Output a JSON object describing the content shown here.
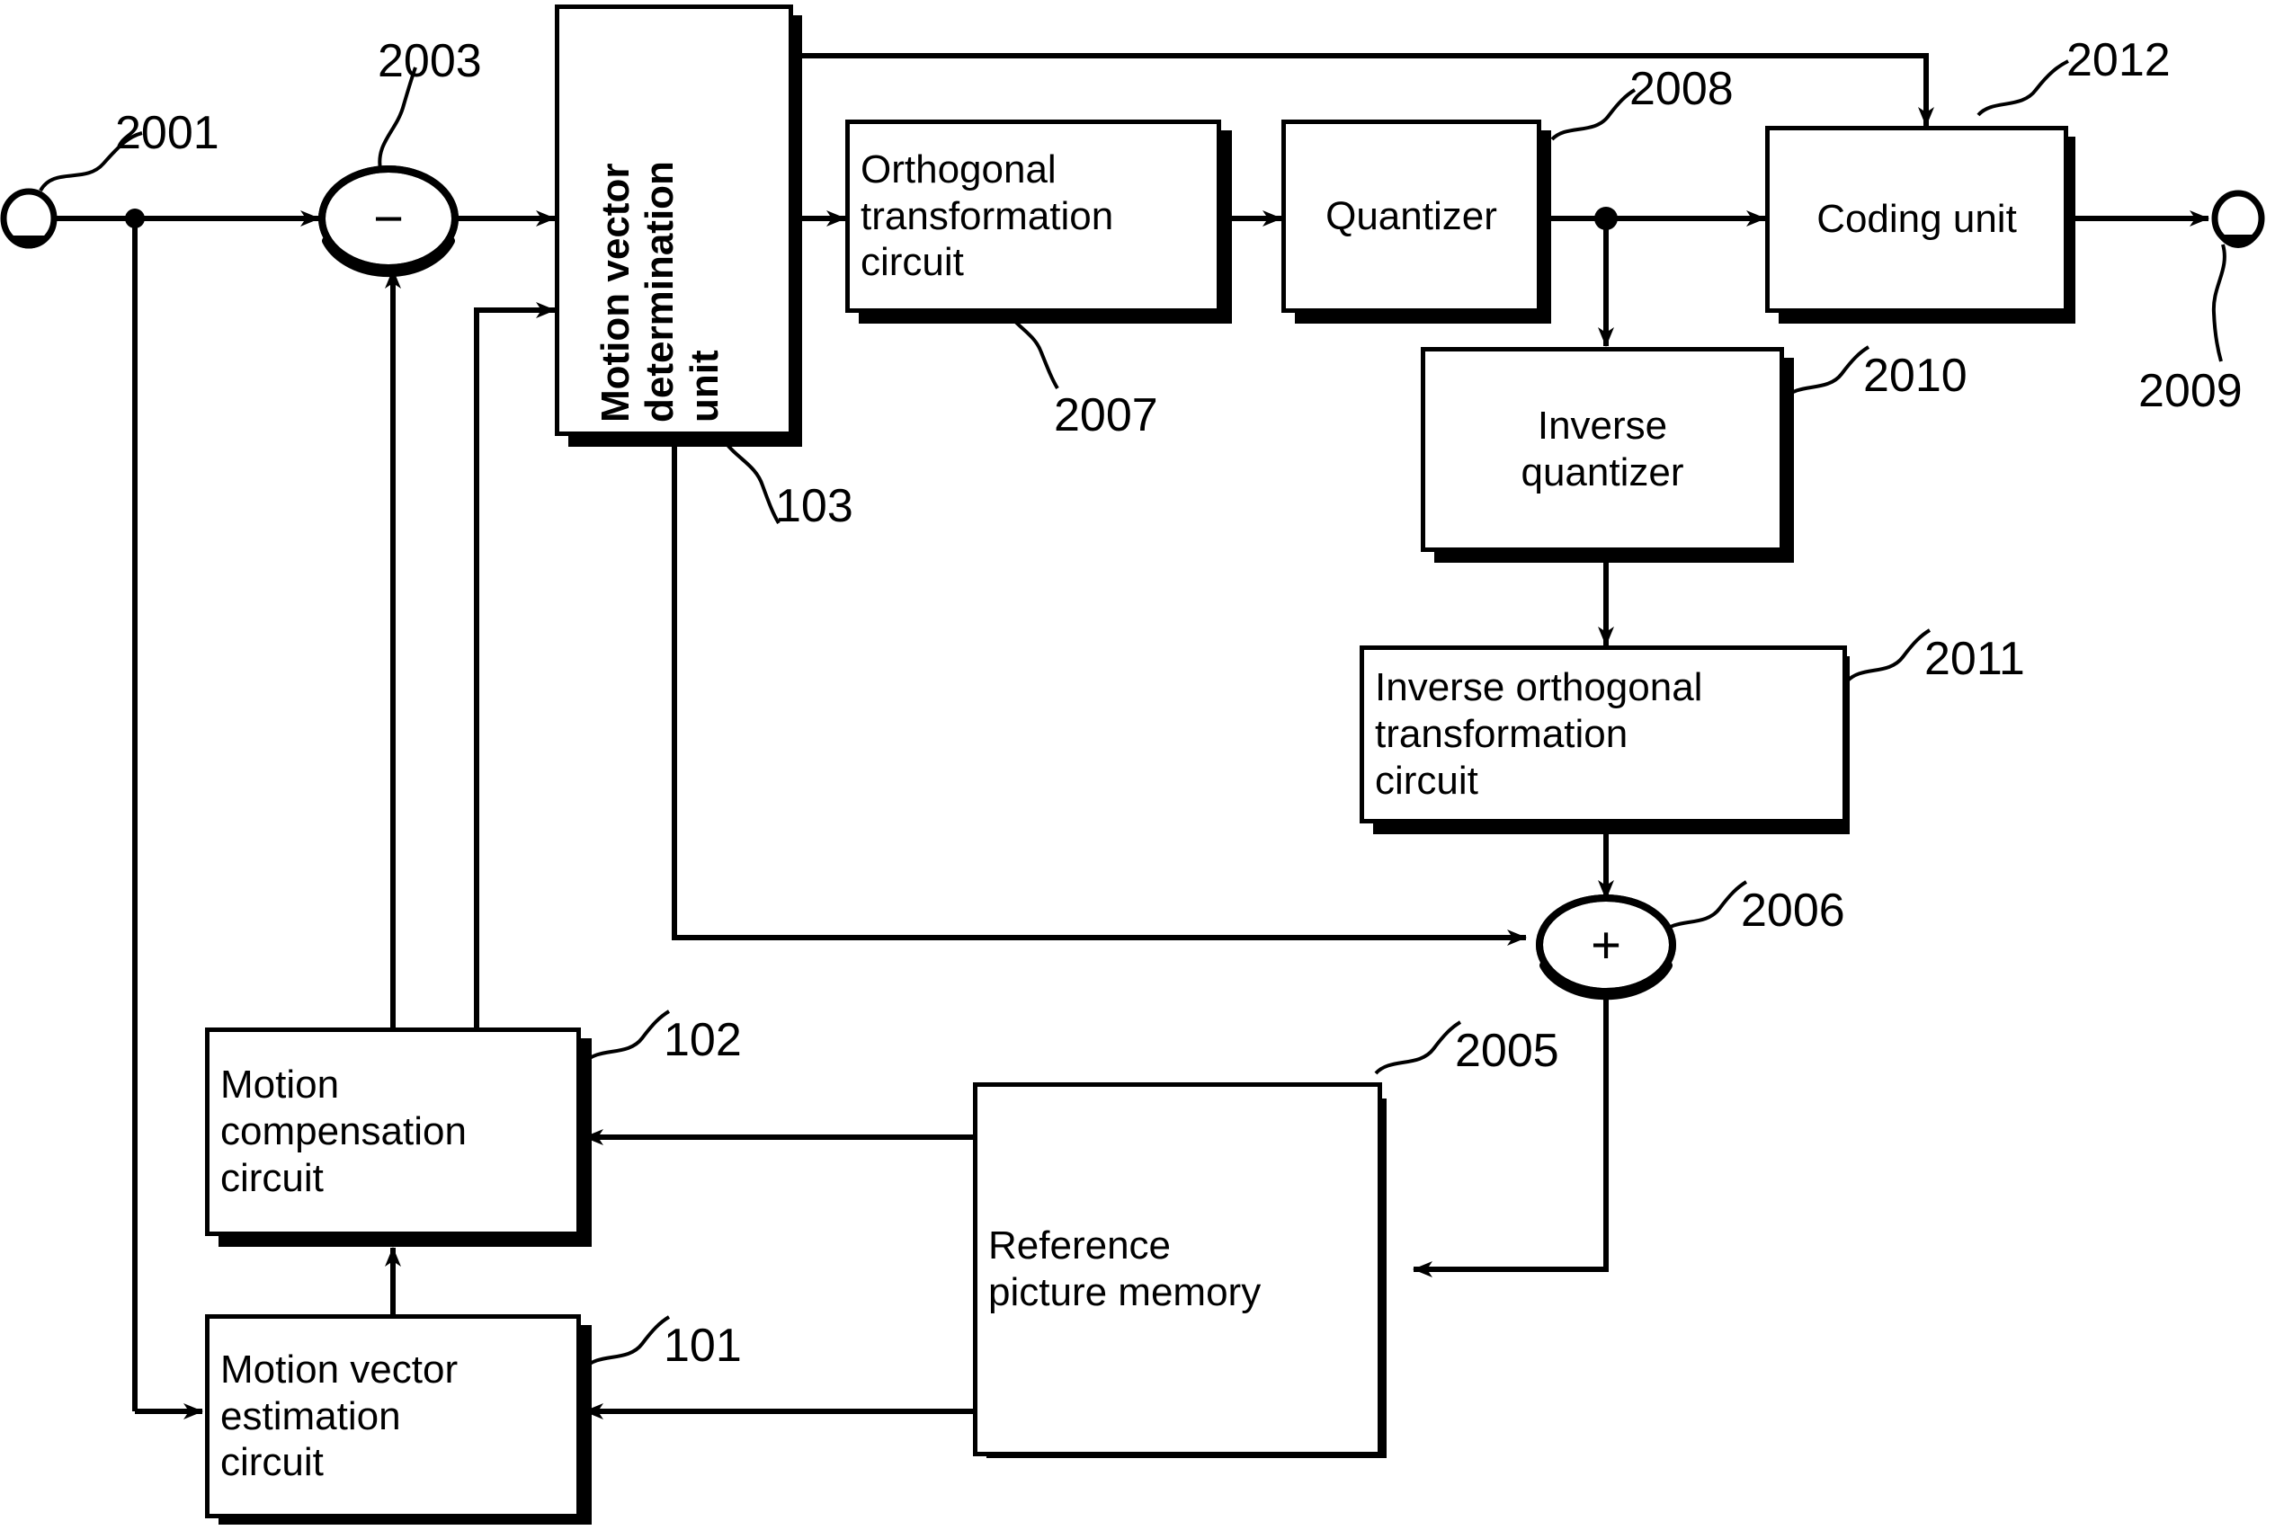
{
  "figure": {
    "type": "patent-block-diagram",
    "description": "Video encoder block diagram with motion vector determination unit",
    "background": "#ffffff",
    "line_color": "#000000"
  },
  "blocks": [
    {
      "id": "mvdu",
      "label": "Motion vector\ndetermination\nunit",
      "ref": "103",
      "orientation": "vertical"
    },
    {
      "id": "ortho",
      "label": "Orthogonal\ntransformation\ncircuit",
      "ref": "2007",
      "orientation": "horizontal"
    },
    {
      "id": "quant",
      "label": "Quantizer",
      "ref": "2008",
      "orientation": "horizontal"
    },
    {
      "id": "coding",
      "label": "Coding unit",
      "ref": "2012",
      "orientation": "horizontal"
    },
    {
      "id": "iquant",
      "label": "Inverse\nquantizer",
      "ref": "2010",
      "orientation": "horizontal"
    },
    {
      "id": "iortho",
      "label": "Inverse orthogonal\ntransformation\ncircuit",
      "ref": "2011",
      "orientation": "horizontal"
    },
    {
      "id": "refmem",
      "label": "Reference\npicture memory",
      "ref": "2005",
      "orientation": "horizontal"
    },
    {
      "id": "mcc",
      "label": "Motion\ncompensation\ncircuit",
      "ref": "102",
      "orientation": "horizontal"
    },
    {
      "id": "mvec",
      "label": "Motion vector\nestimation\ncircuit",
      "ref": "101",
      "orientation": "horizontal"
    }
  ],
  "operators": [
    {
      "id": "subtractor",
      "symbol": "−",
      "ref": "2003",
      "name": "subtractor"
    },
    {
      "id": "adder",
      "symbol": "+",
      "ref": "2006",
      "name": "adder"
    }
  ],
  "terminals": [
    {
      "id": "input_terminal",
      "ref": "2001",
      "name": "video input terminal"
    },
    {
      "id": "output_terminal",
      "ref": "2009",
      "name": "coded stream output terminal"
    }
  ],
  "reference_numerals": {
    "input": "2001",
    "subtractor": "2003",
    "reference_picture_memory": "2005",
    "adder": "2006",
    "orthogonal_transformation_circuit": "2007",
    "quantizer": "2008",
    "output": "2009",
    "inverse_quantizer": "2010",
    "inverse_orthogonal_transformation_circuit": "2011",
    "coding_unit": "2012",
    "motion_vector_estimation_circuit": "101",
    "motion_compensation_circuit": "102",
    "motion_vector_determination_unit": "103"
  }
}
